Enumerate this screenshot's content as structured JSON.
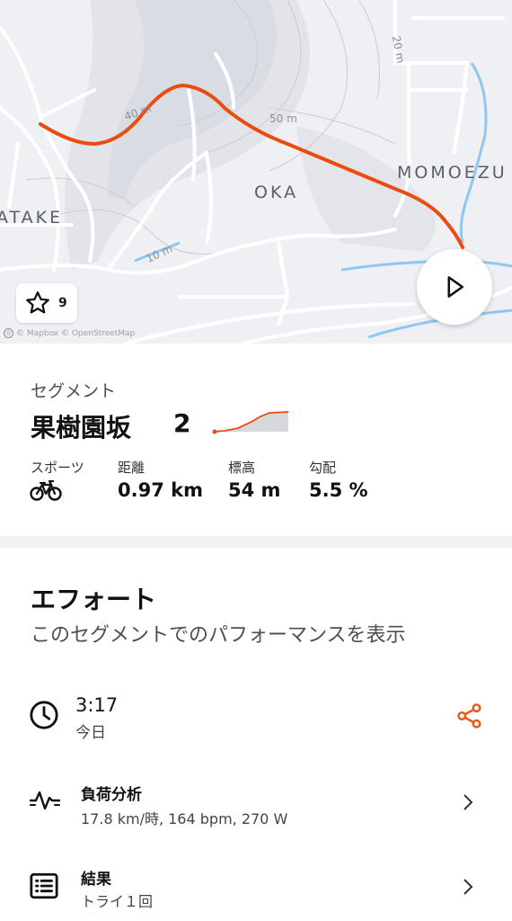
{
  "map": {
    "place_labels": [
      "MOMOEZU",
      "OKA",
      "ATAKE"
    ],
    "contour_labels": [
      "50 m",
      "20 m",
      "40 m",
      "10 m"
    ],
    "attribution": "© Mapbox © OpenStreetMap",
    "route_color": "#ea4c10",
    "favorite_count": "9",
    "icons": {
      "favorite": "star-icon",
      "play": "play-icon"
    }
  },
  "segment": {
    "kicker": "セグメント",
    "name": "果樹園坂",
    "number": "2",
    "stats": [
      {
        "label": "スポーツ",
        "icon": "bike-icon"
      },
      {
        "label": "距離",
        "value": "0.97 km"
      },
      {
        "label": "標高",
        "value": "54 m"
      },
      {
        "label": "勾配",
        "value": "5.5 %"
      }
    ]
  },
  "efforts": {
    "title": "エフォート",
    "subtitle": "このセグメントでのパフォーマンスを表示",
    "time": {
      "value": "3:17",
      "date": "今日",
      "icon": "clock-icon",
      "action_icon": "share-icon",
      "accent": "#ea5a1c"
    },
    "rows": [
      {
        "title": "負荷分析",
        "detail": "17.8 km/時, 164 bpm, 270 W",
        "icon": "heart-rate-icon"
      },
      {
        "title": "結果",
        "detail": "トライ１回",
        "icon": "list-icon"
      }
    ]
  }
}
